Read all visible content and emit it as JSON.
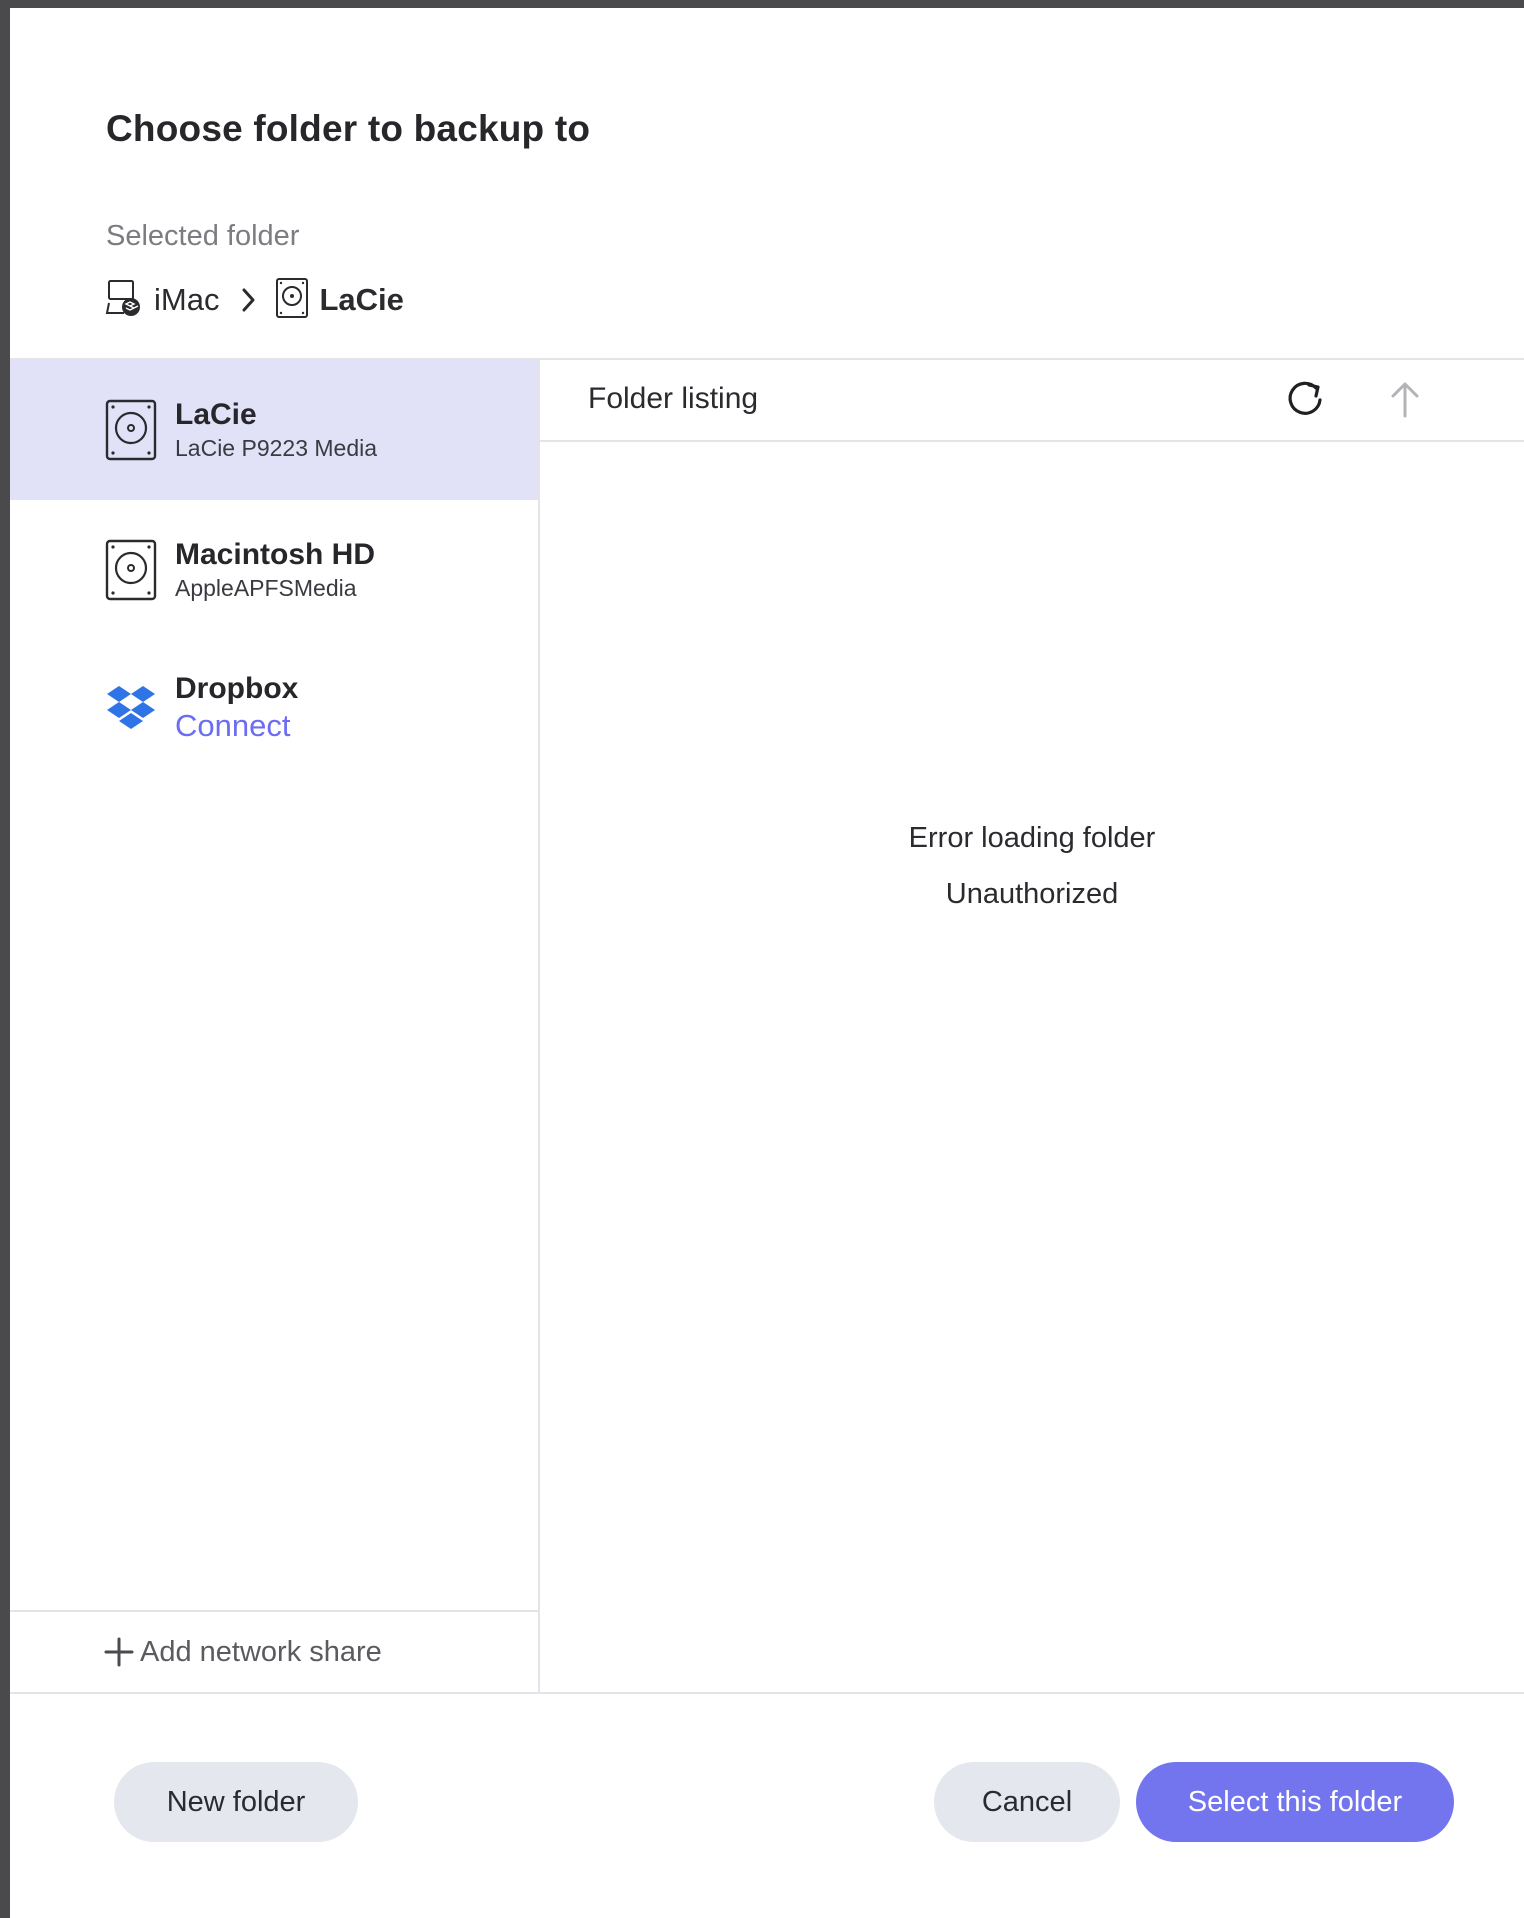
{
  "dialog": {
    "title": "Choose folder to backup to",
    "selected_folder_label": "Selected folder",
    "breadcrumb": [
      {
        "label": "iMac",
        "icon": "imac-dropbox-icon"
      },
      {
        "label": "LaCie",
        "icon": "hard-drive-icon"
      }
    ]
  },
  "sidebar": {
    "items": [
      {
        "name": "LaCie",
        "sub": "LaCie P9223 Media",
        "icon": "hard-drive-icon",
        "active": true
      },
      {
        "name": "Macintosh HD",
        "sub": "AppleAPFSMedia",
        "icon": "hard-drive-icon",
        "active": false
      },
      {
        "name": "Dropbox",
        "link": "Connect",
        "icon": "dropbox-icon",
        "active": false
      }
    ],
    "add_share_label": "Add network share"
  },
  "listing": {
    "header": "Folder listing",
    "error_title": "Error loading folder",
    "error_detail": "Unauthorized"
  },
  "footer": {
    "new_folder_label": "New folder",
    "cancel_label": "Cancel",
    "select_label": "Select this folder"
  },
  "colors": {
    "accent": "#7375ee",
    "active_row": "#e1e2f8",
    "link": "#6c6df0",
    "secondary_button": "#e5e7ef",
    "dropbox_blue": "#2f74e6"
  }
}
